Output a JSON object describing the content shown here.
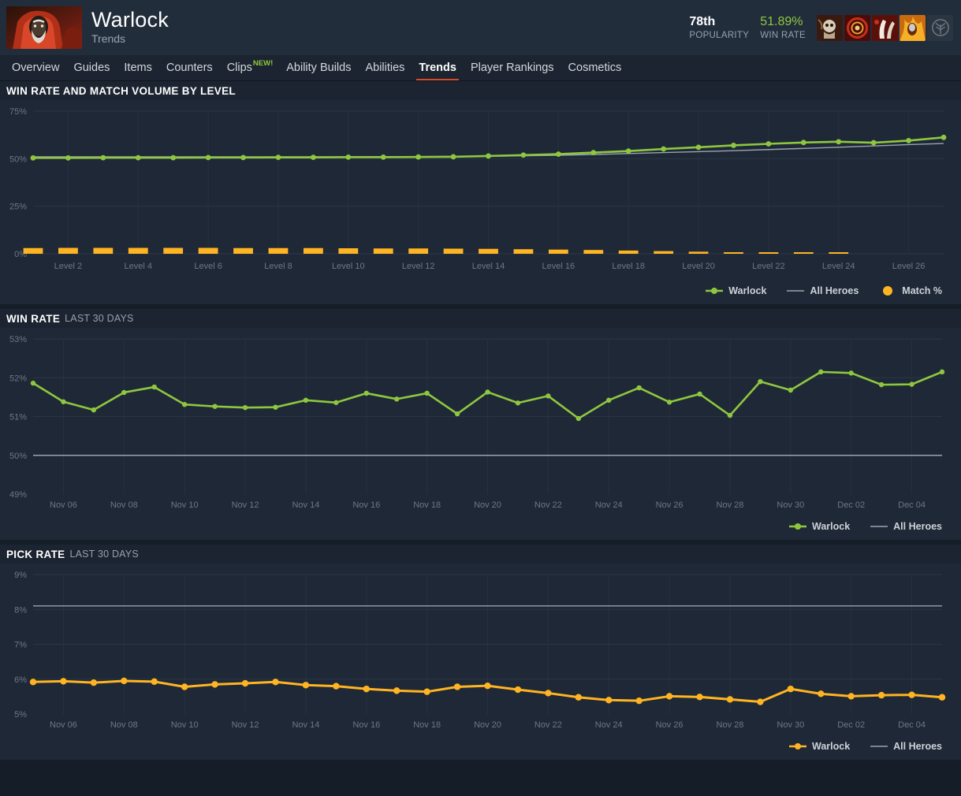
{
  "header": {
    "hero_name": "Warlock",
    "subtitle": "Trends",
    "portrait_alt": "warlock-portrait",
    "popularity_value": "78th",
    "popularity_label": "POPULARITY",
    "winrate_value": "51.89%",
    "winrate_label": "WIN RATE",
    "ability_icons": [
      "fatal-bonds-icon",
      "shadow-word-icon",
      "upheaval-icon",
      "chaotic-offering-icon"
    ],
    "talent_icon": "talent-tree-icon",
    "accent_green": "#8ec73f",
    "accent_orange": "#ffb422",
    "accent_red": "#d94a2b"
  },
  "nav": {
    "items": [
      {
        "label": "Overview",
        "active": false,
        "badge": ""
      },
      {
        "label": "Guides",
        "active": false,
        "badge": ""
      },
      {
        "label": "Items",
        "active": false,
        "badge": ""
      },
      {
        "label": "Counters",
        "active": false,
        "badge": ""
      },
      {
        "label": "Clips",
        "active": false,
        "badge": "NEW!"
      },
      {
        "label": "Ability Builds",
        "active": false,
        "badge": ""
      },
      {
        "label": "Abilities",
        "active": false,
        "badge": ""
      },
      {
        "label": "Trends",
        "active": true,
        "badge": ""
      },
      {
        "label": "Player Rankings",
        "active": false,
        "badge": ""
      },
      {
        "label": "Cosmetics",
        "active": false,
        "badge": ""
      }
    ]
  },
  "panels": [
    {
      "id": "winrate-match-volume-by-level",
      "title": "WIN RATE AND MATCH VOLUME BY LEVEL",
      "subtitle": "",
      "legend": [
        {
          "label": "Warlock",
          "type": "line-dot",
          "color": "#8ec73f"
        },
        {
          "label": "All Heroes",
          "type": "line",
          "color": "#9aa4b0"
        },
        {
          "label": "Match %",
          "type": "dot",
          "color": "#ffb422"
        }
      ]
    },
    {
      "id": "winrate-last-30-days",
      "title": "WIN RATE",
      "subtitle": "LAST 30 DAYS",
      "legend": [
        {
          "label": "Warlock",
          "type": "line-dot",
          "color": "#8ec73f"
        },
        {
          "label": "All Heroes",
          "type": "line",
          "color": "#9aa4b0"
        }
      ]
    },
    {
      "id": "pick-rate-last-30-days",
      "title": "PICK RATE",
      "subtitle": "LAST 30 DAYS",
      "legend": [
        {
          "label": "Warlock",
          "type": "line-dot",
          "color": "#ffb422"
        },
        {
          "label": "All Heroes",
          "type": "line",
          "color": "#9aa4b0"
        }
      ]
    }
  ],
  "chart_data": [
    {
      "type": "line",
      "id": "winrate-match-volume-by-level",
      "title": "WIN RATE AND MATCH VOLUME BY LEVEL",
      "xlabel": "",
      "ylabel": "",
      "ylim": [
        0,
        75
      ],
      "yticks": [
        0,
        25,
        50,
        75
      ],
      "ytick_labels": [
        "0%",
        "25%",
        "50%",
        "75%"
      ],
      "grid": true,
      "legend_position": "bottom-right",
      "x": [
        1,
        2,
        3,
        4,
        5,
        6,
        7,
        8,
        9,
        10,
        11,
        12,
        13,
        14,
        15,
        16,
        17,
        18,
        19,
        20,
        21,
        22,
        23,
        24,
        25,
        26,
        27
      ],
      "xtick_labels": [
        "Level 2",
        "Level 4",
        "Level 6",
        "Level 8",
        "Level 10",
        "Level 12",
        "Level 14",
        "Level 16",
        "Level 18",
        "Level 20",
        "Level 22",
        "Level 24",
        "Level 26"
      ],
      "xtick_positions": [
        2,
        4,
        6,
        8,
        10,
        12,
        14,
        16,
        18,
        20,
        22,
        24,
        26
      ],
      "series": [
        {
          "name": "Warlock",
          "color": "#8ec73f",
          "type": "line-dot",
          "values": [
            50.4,
            50.4,
            50.5,
            50.5,
            50.5,
            50.6,
            50.6,
            50.7,
            50.7,
            50.8,
            50.8,
            50.9,
            51.0,
            51.4,
            51.9,
            52.4,
            53.2,
            54.0,
            55.1,
            56.0,
            57.0,
            57.8,
            58.5,
            58.9,
            58.4,
            59.5,
            61.2
          ]
        },
        {
          "name": "All Heroes",
          "color": "#9aa4b0",
          "type": "line",
          "values": [
            51.0,
            51.0,
            51.0,
            51.0,
            51.0,
            51.0,
            51.0,
            51.0,
            51.0,
            51.0,
            51.1,
            51.1,
            51.2,
            51.3,
            51.5,
            51.8,
            52.2,
            52.7,
            53.2,
            53.7,
            54.2,
            54.8,
            55.4,
            56.0,
            56.7,
            57.4,
            58.0
          ]
        },
        {
          "name": "Match %",
          "color": "#ffb422",
          "type": "bar",
          "values": [
            3.0,
            3.1,
            3.1,
            3.1,
            3.1,
            3.1,
            3.0,
            3.0,
            3.0,
            2.9,
            2.8,
            2.8,
            2.7,
            2.6,
            2.4,
            2.2,
            2.0,
            1.7,
            1.4,
            1.1,
            0.8,
            0.6,
            0.4,
            0.25,
            0,
            0,
            0
          ]
        }
      ]
    },
    {
      "type": "line",
      "id": "winrate-last-30-days",
      "title": "WIN RATE",
      "subtitle": "LAST 30 DAYS",
      "xlabel": "",
      "ylabel": "",
      "ylim": [
        49,
        53
      ],
      "yticks": [
        49,
        50,
        51,
        52,
        53
      ],
      "ytick_labels": [
        "49%",
        "50%",
        "51%",
        "52%",
        "53%"
      ],
      "grid": true,
      "legend_position": "bottom-right",
      "xtick_labels": [
        "Nov 06",
        "Nov 08",
        "Nov 10",
        "Nov 12",
        "Nov 14",
        "Nov 16",
        "Nov 18",
        "Nov 20",
        "Nov 22",
        "Nov 24",
        "Nov 26",
        "Nov 28",
        "Nov 30",
        "Dec 02",
        "Dec 04"
      ],
      "x": [
        "Nov 05",
        "Nov 06",
        "Nov 07",
        "Nov 08",
        "Nov 09",
        "Nov 10",
        "Nov 11",
        "Nov 12",
        "Nov 13",
        "Nov 14",
        "Nov 15",
        "Nov 16",
        "Nov 17",
        "Nov 18",
        "Nov 19",
        "Nov 20",
        "Nov 21",
        "Nov 22",
        "Nov 23",
        "Nov 24",
        "Nov 25",
        "Nov 26",
        "Nov 27",
        "Nov 28",
        "Nov 29",
        "Nov 30",
        "Dec 01",
        "Dec 02",
        "Dec 03",
        "Dec 04",
        "Dec 05"
      ],
      "series": [
        {
          "name": "Warlock",
          "color": "#8ec73f",
          "type": "line-dot",
          "values": [
            51.86,
            51.38,
            51.17,
            51.62,
            51.76,
            51.31,
            51.26,
            51.23,
            51.24,
            51.42,
            51.36,
            51.6,
            51.45,
            51.6,
            51.07,
            51.63,
            51.35,
            51.53,
            50.95,
            51.42,
            51.74,
            51.37,
            51.58,
            51.03,
            51.9,
            51.68,
            52.15,
            52.12,
            51.82,
            51.83,
            52.15
          ]
        },
        {
          "name": "All Heroes",
          "color": "#9aa4b0",
          "type": "line",
          "values": [
            50.0,
            50.0,
            50.0,
            50.0,
            50.0,
            50.0,
            50.0,
            50.0,
            50.0,
            50.0,
            50.0,
            50.0,
            50.0,
            50.0,
            50.0,
            50.0,
            50.0,
            50.0,
            50.0,
            50.0,
            50.0,
            50.0,
            50.0,
            50.0,
            50.0,
            50.0,
            50.0,
            50.0,
            50.0,
            50.0,
            50.0
          ]
        }
      ]
    },
    {
      "type": "line",
      "id": "pick-rate-last-30-days",
      "title": "PICK RATE",
      "subtitle": "LAST 30 DAYS",
      "xlabel": "",
      "ylabel": "",
      "ylim": [
        5,
        9
      ],
      "yticks": [
        5,
        6,
        7,
        8,
        9
      ],
      "ytick_labels": [
        "5%",
        "6%",
        "7%",
        "8%",
        "9%"
      ],
      "grid": true,
      "legend_position": "bottom-right",
      "xtick_labels": [
        "Nov 06",
        "Nov 08",
        "Nov 10",
        "Nov 12",
        "Nov 14",
        "Nov 16",
        "Nov 18",
        "Nov 20",
        "Nov 22",
        "Nov 24",
        "Nov 26",
        "Nov 28",
        "Nov 30",
        "Dec 02",
        "Dec 04"
      ],
      "x": [
        "Nov 05",
        "Nov 06",
        "Nov 07",
        "Nov 08",
        "Nov 09",
        "Nov 10",
        "Nov 11",
        "Nov 12",
        "Nov 13",
        "Nov 14",
        "Nov 15",
        "Nov 16",
        "Nov 17",
        "Nov 18",
        "Nov 19",
        "Nov 20",
        "Nov 21",
        "Nov 22",
        "Nov 23",
        "Nov 24",
        "Nov 25",
        "Nov 26",
        "Nov 27",
        "Nov 28",
        "Nov 29",
        "Nov 30",
        "Dec 01",
        "Dec 02",
        "Dec 03",
        "Dec 04",
        "Dec 05"
      ],
      "series": [
        {
          "name": "Warlock",
          "color": "#ffb422",
          "type": "line-dot",
          "values": [
            5.92,
            5.94,
            5.9,
            5.95,
            5.93,
            5.78,
            5.85,
            5.88,
            5.92,
            5.83,
            5.8,
            5.72,
            5.67,
            5.64,
            5.78,
            5.81,
            5.7,
            5.6,
            5.48,
            5.4,
            5.38,
            5.51,
            5.49,
            5.42,
            5.35,
            5.72,
            5.58,
            5.51,
            5.54,
            5.55,
            5.48
          ]
        },
        {
          "name": "All Heroes",
          "color": "#9aa4b0",
          "type": "line",
          "values": [
            8.1,
            8.1,
            8.1,
            8.1,
            8.1,
            8.1,
            8.1,
            8.1,
            8.1,
            8.1,
            8.1,
            8.1,
            8.1,
            8.1,
            8.1,
            8.1,
            8.1,
            8.1,
            8.1,
            8.1,
            8.1,
            8.1,
            8.1,
            8.1,
            8.1,
            8.1,
            8.1,
            8.1,
            8.1,
            8.1,
            8.1
          ]
        }
      ]
    }
  ]
}
